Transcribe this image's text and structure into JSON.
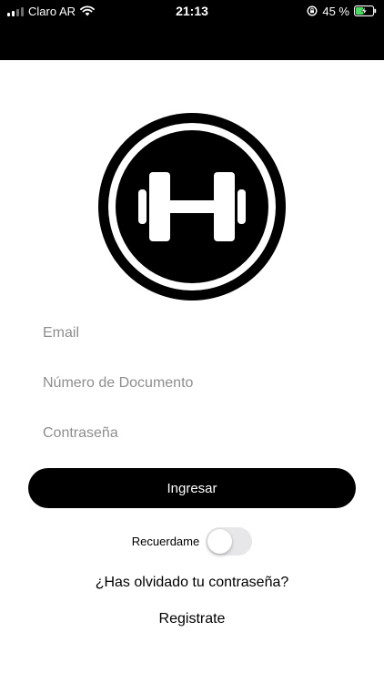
{
  "status_bar": {
    "carrier": "Claro AR",
    "time": "21:13",
    "battery_percent": "45 %",
    "battery_level": 0.45,
    "icons": [
      "signal-icon",
      "wifi-icon",
      "orientation-lock-icon",
      "battery-charging-icon"
    ]
  },
  "logo": {
    "icon": "dumbbell-logo-icon"
  },
  "form": {
    "email_placeholder": "Email",
    "document_placeholder": "Número de Documento",
    "password_placeholder": "Contraseña",
    "login_label": "Ingresar",
    "remember_label": "Recuerdame",
    "remember_on": false
  },
  "links": {
    "forgot_password": "¿Has olvidado tu contraseña?",
    "register": "Registrate"
  },
  "colors": {
    "primary": "#000000",
    "background": "#ffffff",
    "placeholder": "#8e8e8e",
    "toggle_off": "#e7e7e9",
    "battery_charge": "#4cd964"
  }
}
